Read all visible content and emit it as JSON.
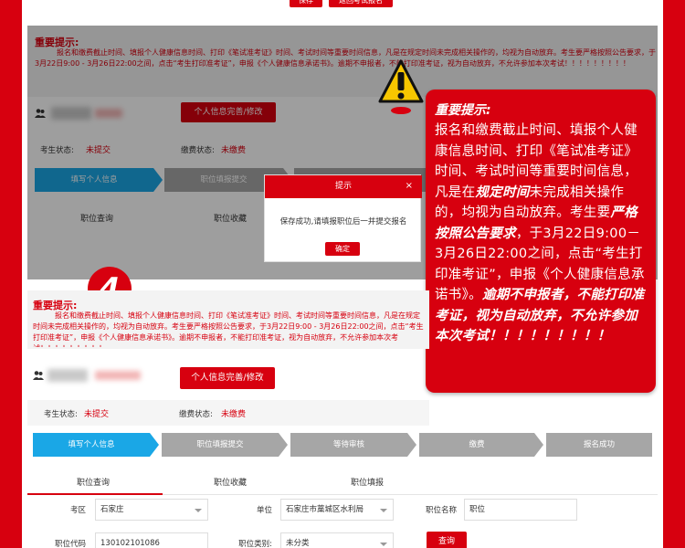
{
  "top_buttons": {
    "save": "保存",
    "back": "返回考试报名"
  },
  "notice": {
    "title": "重要提示:",
    "text": "报名和缴费截止时间、填报个人健康信息时间、打印《笔试准考证》时间、考试时间等重要时间信息，凡是在规定时间未完成相关操作的，均视为自动放弃。考生要严格按照公告要求，于3月22日9:00 - 3月26日22:00之间，点击“考生打印准考证”，申报《个人健康信息承诺书》。逾期不申报者，不能打印准考证，视为自动放弃，不允许参加本次考试！！！！！！！！！"
  },
  "profile": {
    "edit_button": "个人信息完善/修改"
  },
  "status": {
    "exam_label": "考生状态:",
    "exam_value": "未提交",
    "fee_label": "缴费状态:",
    "fee_value": "未缴费"
  },
  "steps": [
    "填写个人信息",
    "职位填报提交",
    "等待审核",
    "缴费",
    "报名成功"
  ],
  "tabs": [
    "职位查询",
    "职位收藏",
    "职位填报"
  ],
  "modal": {
    "title": "提示",
    "message": "保存成功,请填报职位后一并提交报名",
    "ok": "确定",
    "close": "×"
  },
  "step_number": "4",
  "callout": {
    "title": "重要提示:",
    "p1": "报名和缴费截止时间、填报个人健康信息时间、打印《笔试准考证》时间、考试时间等重要时间信息，凡是在",
    "p1_bold": "规定时间",
    "p1_end": "未完成相关操作的，均视为自动放弃。",
    "p2": "考生要",
    "p2_bold": "严格按照公告要求",
    "p2_end": "，于3月22日9:00－3月26日22:00之间，点击“考生打印准考证”，申报《个人健康信息承诺书》。",
    "p3_bold": "逾期不申报者，不能打印准考证，视为自动放弃，不允许参加本次考试！！！！！！！！！"
  },
  "search_form": {
    "area_label": "考区",
    "area_value": "石家庄",
    "unit_label": "单位",
    "unit_value": "石家庄市藁城区水利局",
    "position_name_label": "职位名称",
    "position_name_value": "职位",
    "position_code_label": "职位代码",
    "position_code_value": "130102101086",
    "position_type_label": "职位类别:",
    "position_type_value": "未分类",
    "search_button": "查询"
  },
  "colors": {
    "brand_red": "#d7000f",
    "step_active": "#1aa7e6",
    "step_inactive": "#a6a6a6"
  }
}
